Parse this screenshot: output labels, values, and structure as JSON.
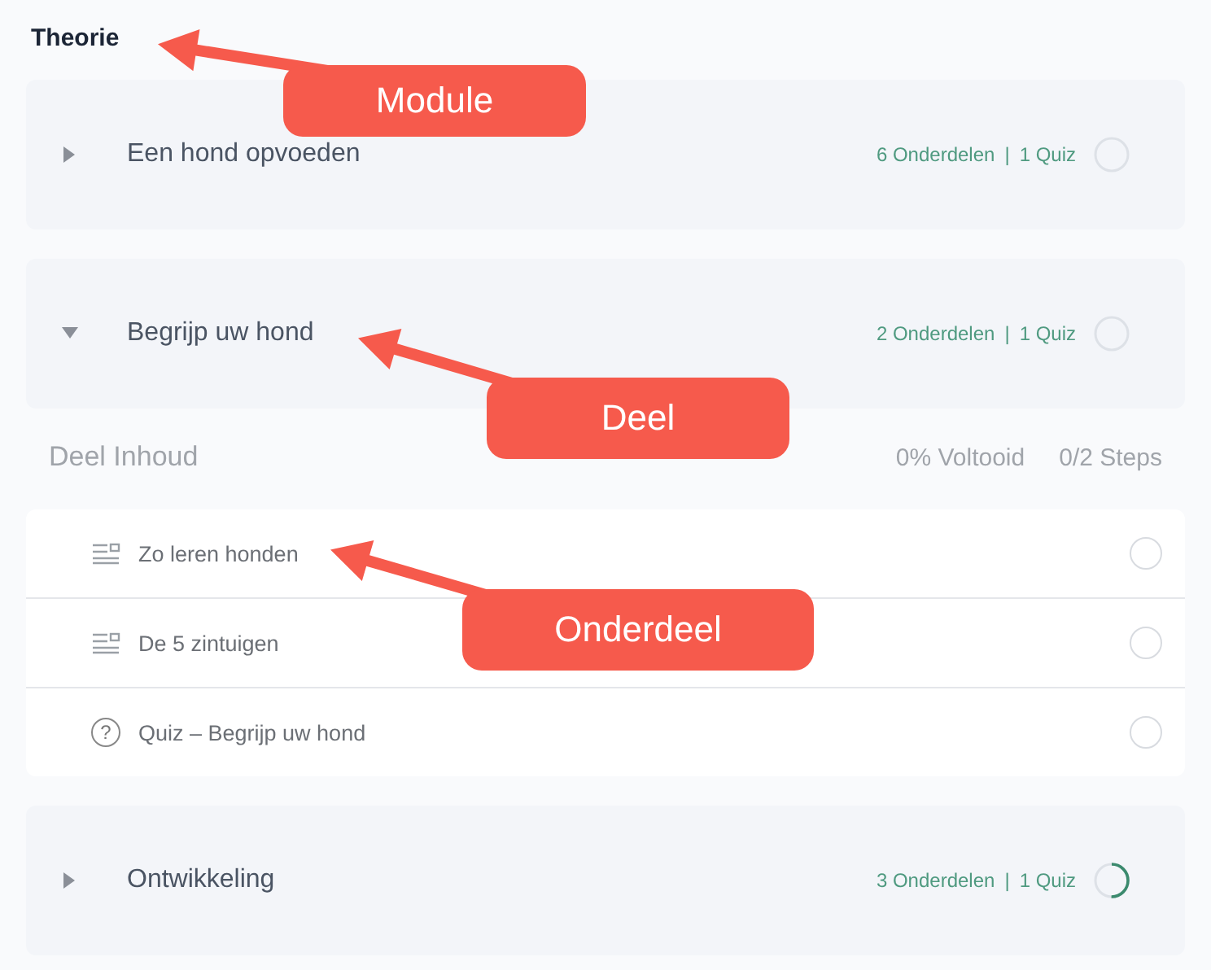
{
  "section_title": "Theorie",
  "modules": [
    {
      "title": "Een hond opvoeden",
      "expanded": false,
      "parts": "6 Onderdelen",
      "separator": "|",
      "quiz": "1 Quiz",
      "started": false
    },
    {
      "title": "Begrijp uw hond",
      "expanded": true,
      "parts": "2 Onderdelen",
      "separator": "|",
      "quiz": "1 Quiz",
      "started": false,
      "content": {
        "title": "Deel Inhoud",
        "progress": "0% Voltooid",
        "steps": "0/2 Steps",
        "items": [
          {
            "kind": "text",
            "title": "Zo leren honden",
            "checked": false
          },
          {
            "kind": "text",
            "title": "De 5 zintuigen",
            "checked": false
          },
          {
            "kind": "quiz",
            "icon": "?",
            "title": "Quiz – Begrijp uw hond",
            "checked": false
          }
        ]
      }
    },
    {
      "title": "Ontwikkeling",
      "expanded": false,
      "parts": "3 Onderdelen",
      "separator": "|",
      "quiz": "1 Quiz",
      "started": true
    }
  ],
  "callouts": [
    {
      "label": "Module"
    },
    {
      "label": "Deel"
    },
    {
      "label": "Onderdeel"
    }
  ]
}
